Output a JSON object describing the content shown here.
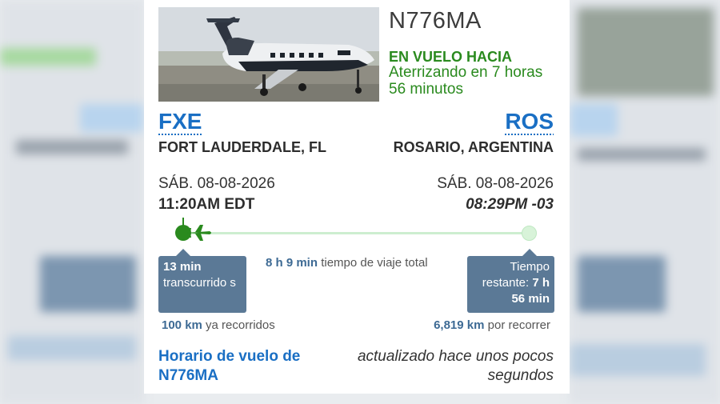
{
  "flight": {
    "tail": "N776MA",
    "status": "EN VUELO HACIA",
    "eta_text": "Aterrizando en 7 horas 56 minutos"
  },
  "origin": {
    "code": "FXE",
    "city": "FORT LAUDERDALE, FL",
    "date": "SÁB. 08-08-2026",
    "time": "11:20AM EDT"
  },
  "destination": {
    "code": "ROS",
    "city": "ROSARIO, ARGENTINA",
    "date": "SÁB. 08-08-2026",
    "time": "08:29PM -03"
  },
  "progress": {
    "elapsed_value": "13 min",
    "elapsed_label": "transcurrido s",
    "total_value": "8 h 9 min",
    "total_label": "tiempo de viaje total",
    "remaining_label": "Tiempo restante:",
    "remaining_value": "7 h 56 min",
    "flown_value": "100 km",
    "flown_label": "ya recorridos",
    "to_go_value": "6,819 km",
    "to_go_label": "por recorrer"
  },
  "footer": {
    "schedule_link": "Horario de vuelo de N776MA",
    "updated_text": "actualizado hace unos pocos segundos"
  },
  "colors": {
    "accent_blue": "#1a6fc4",
    "status_green": "#2a8a1e",
    "bubble": "#5b7996"
  }
}
